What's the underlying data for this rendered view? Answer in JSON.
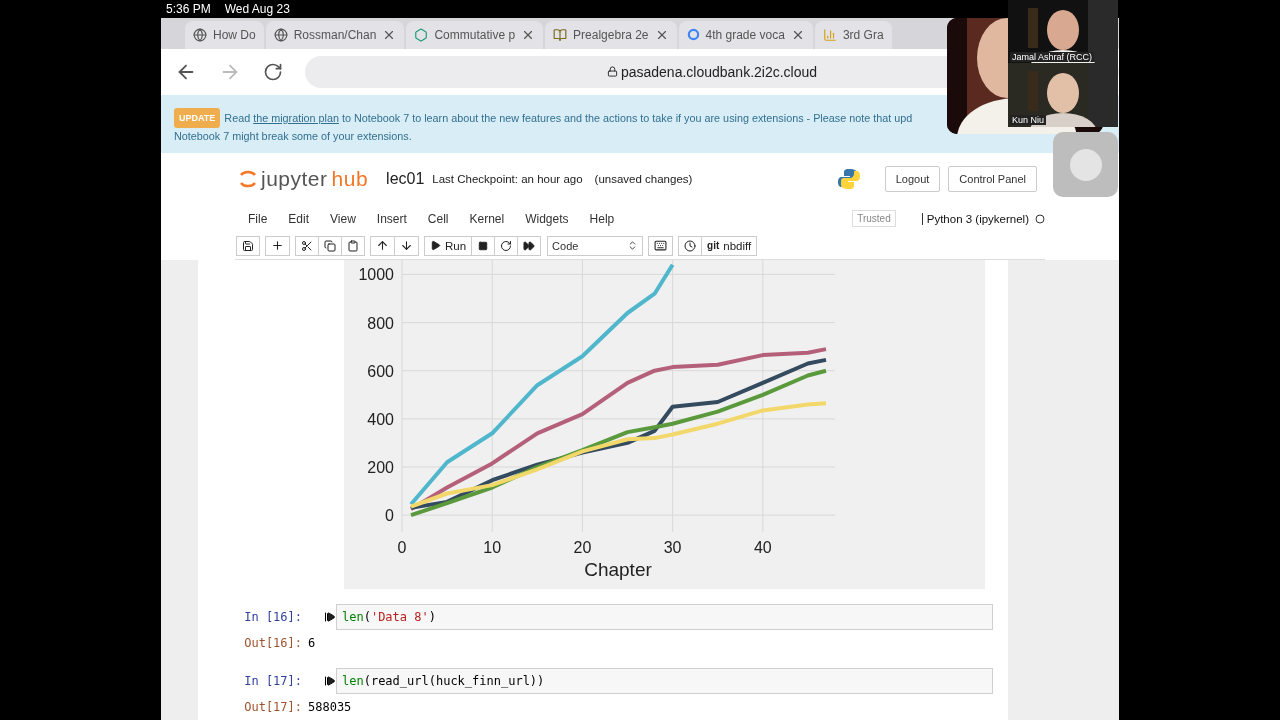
{
  "status_bar": {
    "time": "5:36 PM",
    "date": "Wed Aug 23"
  },
  "tabs": [
    {
      "label": "How Do",
      "kind": "globe",
      "closable": false
    },
    {
      "label": "Rossman/Chan",
      "kind": "globe",
      "closable": true
    },
    {
      "label": "Commutative p",
      "kind": "hexagon",
      "closable": true
    },
    {
      "label": "Prealgebra 2e",
      "kind": "book",
      "closable": true
    },
    {
      "label": "4th grade voca",
      "kind": "google",
      "closable": true
    },
    {
      "label": "3rd Gra",
      "kind": "chart",
      "closable": false
    }
  ],
  "address_bar": {
    "url": "pasadena.cloudbank.2i2c.cloud"
  },
  "banner": {
    "badge": "UPDATE",
    "before": "Read",
    "link": "the migration plan",
    "after": "to Notebook 7 to learn about the new features and the actions to take if you are using extensions - Please note that upd",
    "line2": "Notebook 7 might break some of your extensions."
  },
  "header": {
    "logo_left": "jupyter",
    "logo_right": "hub",
    "notebook": "lec01",
    "checkpoint": "Last Checkpoint: an hour ago",
    "unsaved": "(unsaved changes)",
    "buttons": [
      "Logout",
      "Control Panel"
    ]
  },
  "menu": [
    "File",
    "Edit",
    "View",
    "Insert",
    "Cell",
    "Kernel",
    "Widgets",
    "Help"
  ],
  "trusted": "Trusted",
  "kernel": "Python 3 (ipykernel)",
  "toolbar": {
    "run": "Run",
    "cell_type": "Code",
    "git": "git",
    "nbdiff": "nbdiff"
  },
  "chart": {
    "chart_data": {
      "type": "line",
      "grid": true,
      "xlabel": "Chapter",
      "x": [
        1,
        5,
        10,
        15,
        20,
        25,
        28,
        30,
        35,
        40,
        45,
        47
      ],
      "xlim": [
        0,
        48
      ],
      "ylim": [
        -70,
        1060
      ],
      "xticks": [
        0,
        10,
        20,
        30,
        40
      ],
      "yticks": [
        0,
        200,
        400,
        600,
        800,
        1000
      ],
      "series": [
        {
          "color": "#4fb6cc",
          "values": [
            45,
            220,
            340,
            540,
            660,
            840,
            920,
            1040,
            null,
            null,
            null,
            null
          ]
        },
        {
          "color": "#b5607a",
          "values": [
            25,
            115,
            215,
            340,
            420,
            550,
            600,
            615,
            625,
            665,
            675,
            690
          ]
        },
        {
          "color": "#344a5e",
          "values": [
            30,
            55,
            145,
            210,
            260,
            300,
            350,
            450,
            470,
            550,
            630,
            645
          ]
        },
        {
          "color": "#5a9a3c",
          "values": [
            0,
            50,
            115,
            200,
            270,
            345,
            365,
            380,
            430,
            500,
            580,
            600
          ]
        },
        {
          "color": "#f2d86a",
          "values": [
            35,
            90,
            125,
            190,
            265,
            315,
            320,
            335,
            380,
            435,
            460,
            465
          ]
        }
      ]
    }
  },
  "cells": [
    {
      "in_prompt": "In [16]:",
      "code": [
        {
          "text": "len",
          "kind": "builtin"
        },
        {
          "text": "(",
          "kind": "plain"
        },
        {
          "text": "'Data 8'",
          "kind": "string"
        },
        {
          "text": ")",
          "kind": "plain"
        }
      ],
      "out_prompt": "Out[16]:",
      "output": "6"
    },
    {
      "in_prompt": "In [17]:",
      "code": [
        {
          "text": "len",
          "kind": "builtin"
        },
        {
          "text": "(read_url(huck_finn_url))",
          "kind": "plain"
        }
      ],
      "out_prompt": "Out[17]:",
      "output": "588035"
    }
  ],
  "video": {
    "participants": [
      {
        "name": "Jamal Ashraf (RCC)"
      },
      {
        "name": "Kun Niu"
      }
    ]
  }
}
